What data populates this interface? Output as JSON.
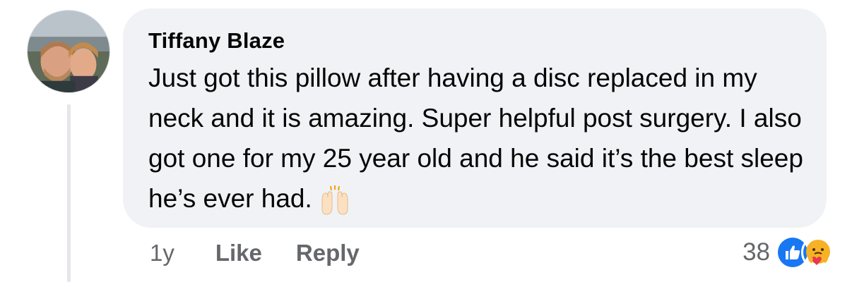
{
  "comment": {
    "author": "Tiffany Blaze",
    "text": "Just got this pillow after having a disc replaced in my neck and it is amazing. Super helpful post surgery. I also got one for my 25 year old and he said it’s the best sleep he’s ever had.",
    "emoji": "raising-hands-icon",
    "age": "1y",
    "like_label": "Like",
    "reply_label": "Reply",
    "reaction_count": "38",
    "reactions": [
      "like-reaction-icon",
      "care-reaction-icon"
    ]
  },
  "colors": {
    "bubble": "#f0f2f5",
    "text": "#050505",
    "secondary": "#65676b",
    "like_blue": "#1877f2",
    "care_yellow": "#f7b125"
  }
}
